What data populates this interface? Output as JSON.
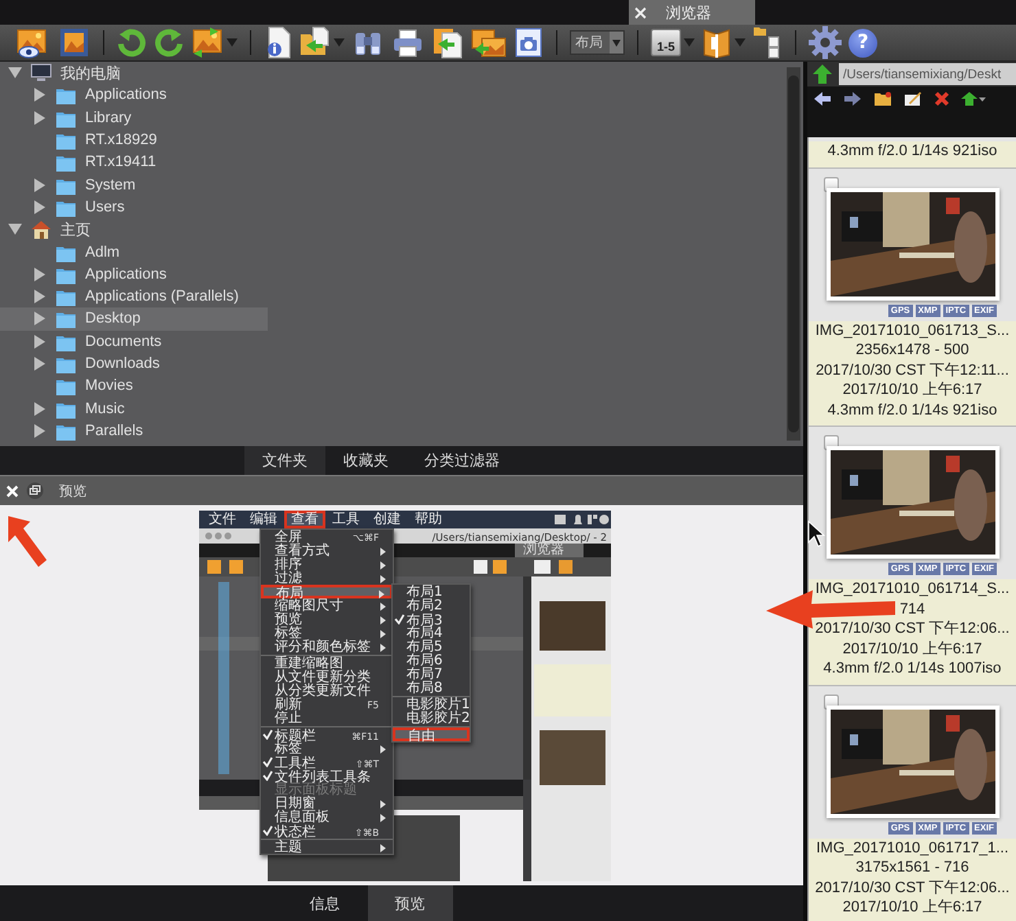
{
  "top_bar": {
    "tab": {
      "title": "浏览器"
    }
  },
  "toolbar": {
    "layout_dropdown": {
      "value": "布局"
    },
    "range_label": "1-5",
    "help_label": "?"
  },
  "folder_tree": {
    "items": [
      {
        "kind": "computer",
        "label": "我的电脑",
        "expandable": true,
        "expanded": true,
        "selected": false,
        "children": [
          {
            "kind": "folder",
            "label": "Applications",
            "expandable": true,
            "expanded": false,
            "selected": false
          },
          {
            "kind": "folder",
            "label": "Library",
            "expandable": true,
            "expanded": false,
            "selected": false
          },
          {
            "kind": "folder",
            "label": "RT.x18929",
            "expandable": false,
            "expanded": false,
            "selected": false
          },
          {
            "kind": "folder",
            "label": "RT.x19411",
            "expandable": false,
            "expanded": false,
            "selected": false
          },
          {
            "kind": "folder",
            "label": "System",
            "expandable": true,
            "expanded": false,
            "selected": false
          },
          {
            "kind": "folder",
            "label": "Users",
            "expandable": true,
            "expanded": false,
            "selected": false
          }
        ]
      },
      {
        "kind": "home",
        "label": "主页",
        "expandable": true,
        "expanded": true,
        "selected": false,
        "children": [
          {
            "kind": "folder",
            "label": "Adlm",
            "expandable": false,
            "expanded": false,
            "selected": false
          },
          {
            "kind": "folder",
            "label": "Applications",
            "expandable": true,
            "expanded": false,
            "selected": false
          },
          {
            "kind": "folder",
            "label": "Applications (Parallels)",
            "expandable": true,
            "expanded": false,
            "selected": false
          },
          {
            "kind": "folder",
            "label": "Desktop",
            "expandable": true,
            "expanded": false,
            "selected": true
          },
          {
            "kind": "folder",
            "label": "Documents",
            "expandable": true,
            "expanded": false,
            "selected": false
          },
          {
            "kind": "folder",
            "label": "Downloads",
            "expandable": true,
            "expanded": false,
            "selected": false
          },
          {
            "kind": "folder",
            "label": "Movies",
            "expandable": false,
            "expanded": false,
            "selected": false
          },
          {
            "kind": "folder",
            "label": "Music",
            "expandable": true,
            "expanded": false,
            "selected": false
          },
          {
            "kind": "folder",
            "label": "Parallels",
            "expandable": true,
            "expanded": false,
            "selected": false
          }
        ]
      }
    ]
  },
  "folder_tabs": [
    {
      "label": "文件夹",
      "selected": true
    },
    {
      "label": "收藏夹",
      "selected": false
    },
    {
      "label": "分类过滤器",
      "selected": false
    }
  ],
  "preview_panel": {
    "title": "预览",
    "image": {
      "menu_bar": [
        {
          "label": "文件",
          "marked": false
        },
        {
          "label": "编辑",
          "marked": false
        },
        {
          "label": "查看",
          "marked": true
        },
        {
          "label": "工具",
          "marked": false
        },
        {
          "label": "创建",
          "marked": false
        },
        {
          "label": "帮助",
          "marked": false
        }
      ],
      "window_path": "/Users/tiansemixiang/Desktop/ - 2",
      "window_tab": "浏览器",
      "menu": [
        {
          "kind": "item",
          "label": "全屏",
          "shortcut": "⌥⌘F",
          "checked": false,
          "has_submenu": false,
          "disabled": false,
          "marked": false
        },
        {
          "kind": "item",
          "label": "查看方式",
          "checked": false,
          "has_submenu": true,
          "disabled": false,
          "marked": false
        },
        {
          "kind": "item",
          "label": "排序",
          "checked": false,
          "has_submenu": true,
          "disabled": false,
          "marked": false
        },
        {
          "kind": "item",
          "label": "过滤",
          "checked": false,
          "has_submenu": true,
          "disabled": false,
          "marked": false
        },
        {
          "kind": "item",
          "label": "布局",
          "checked": false,
          "has_submenu": true,
          "disabled": false,
          "marked": true
        },
        {
          "kind": "item",
          "label": "缩略图尺寸",
          "checked": false,
          "has_submenu": true,
          "disabled": false,
          "marked": false
        },
        {
          "kind": "item",
          "label": "预览",
          "checked": false,
          "has_submenu": true,
          "disabled": false,
          "marked": false
        },
        {
          "kind": "item",
          "label": "标签",
          "checked": false,
          "has_submenu": true,
          "disabled": false,
          "marked": false
        },
        {
          "kind": "item",
          "label": "评分和颜色标签",
          "checked": false,
          "has_submenu": true,
          "disabled": false,
          "marked": false
        },
        {
          "kind": "separator"
        },
        {
          "kind": "item",
          "label": "重建缩略图",
          "checked": false,
          "has_submenu": false,
          "disabled": false,
          "marked": false
        },
        {
          "kind": "item",
          "label": "从文件更新分类",
          "checked": false,
          "has_submenu": false,
          "disabled": false,
          "marked": false
        },
        {
          "kind": "item",
          "label": "从分类更新文件",
          "checked": false,
          "has_submenu": false,
          "disabled": false,
          "marked": false
        },
        {
          "kind": "item",
          "label": "刷新",
          "shortcut": "F5",
          "checked": false,
          "has_submenu": false,
          "disabled": false,
          "marked": false
        },
        {
          "kind": "item",
          "label": "停止",
          "checked": false,
          "has_submenu": false,
          "disabled": false,
          "marked": false
        },
        {
          "kind": "separator"
        },
        {
          "kind": "item",
          "label": "标题栏",
          "shortcut": "⌘F11",
          "checked": true,
          "has_submenu": false,
          "disabled": false,
          "marked": false
        },
        {
          "kind": "item",
          "label": "标签",
          "checked": false,
          "has_submenu": true,
          "disabled": false,
          "marked": false
        },
        {
          "kind": "item",
          "label": "工具栏",
          "shortcut": "⇧⌘T",
          "checked": true,
          "has_submenu": false,
          "disabled": false,
          "marked": false
        },
        {
          "kind": "item",
          "label": "文件列表工具条",
          "checked": true,
          "has_submenu": false,
          "disabled": false,
          "marked": false
        },
        {
          "kind": "item",
          "label": "显示面板标题",
          "checked": false,
          "has_submenu": false,
          "disabled": true,
          "marked": false
        },
        {
          "kind": "item",
          "label": "日期窗",
          "checked": false,
          "has_submenu": true,
          "disabled": false,
          "marked": false
        },
        {
          "kind": "item",
          "label": "信息面板",
          "checked": false,
          "has_submenu": true,
          "disabled": false,
          "marked": false
        },
        {
          "kind": "item",
          "label": "状态栏",
          "shortcut": "⇧⌘B",
          "checked": true,
          "has_submenu": false,
          "disabled": false,
          "marked": false
        },
        {
          "kind": "separator"
        },
        {
          "kind": "item",
          "label": "主题",
          "checked": false,
          "has_submenu": true,
          "disabled": false,
          "marked": false
        }
      ],
      "submenu": [
        {
          "kind": "item",
          "label": "布局1",
          "checked": false,
          "marked": false
        },
        {
          "kind": "item",
          "label": "布局2",
          "checked": false,
          "marked": false
        },
        {
          "kind": "item",
          "label": "布局3",
          "checked": true,
          "marked": false
        },
        {
          "kind": "item",
          "label": "布局4",
          "checked": false,
          "marked": false
        },
        {
          "kind": "item",
          "label": "布局5",
          "checked": false,
          "marked": false
        },
        {
          "kind": "item",
          "label": "布局6",
          "checked": false,
          "marked": false
        },
        {
          "kind": "item",
          "label": "布局7",
          "checked": false,
          "marked": false
        },
        {
          "kind": "item",
          "label": "布局8",
          "checked": false,
          "marked": false
        },
        {
          "kind": "separator"
        },
        {
          "kind": "item",
          "label": "电影胶片1",
          "checked": false,
          "marked": false
        },
        {
          "kind": "item",
          "label": "电影胶片2",
          "checked": false,
          "marked": false
        },
        {
          "kind": "separator"
        },
        {
          "kind": "item",
          "label": "自由",
          "checked": false,
          "marked": true
        }
      ]
    }
  },
  "bottom_tabs": [
    {
      "label": "信息",
      "selected": false
    },
    {
      "label": "预览",
      "selected": true
    }
  ],
  "browser_panel": {
    "path": "/Users/tiansemixiang/Deskt",
    "thumbnails": [
      {
        "kind": "caption_only",
        "lines": [
          "4.3mm f/2.0 1/14s 921iso"
        ]
      },
      {
        "kind": "full",
        "checked": false,
        "tags": [
          "GPS",
          "XMP",
          "IPTC",
          "EXIF"
        ],
        "lines": [
          "IMG_20171010_061713_S...",
          "2356x1478 - 500",
          "2017/10/30 CST 下午12:11...",
          "2017/10/10 上午6:17",
          "4.3mm f/2.0 1/14s 921iso"
        ]
      },
      {
        "kind": "full",
        "checked": false,
        "tags": [
          "GPS",
          "XMP",
          "IPTC",
          "EXIF"
        ],
        "lines": [
          "IMG_20171010_061714_S...",
          "714",
          "2017/10/30 CST 下午12:06...",
          "2017/10/10 上午6:17",
          "4.3mm f/2.0 1/14s 1007iso"
        ]
      },
      {
        "kind": "full",
        "checked": false,
        "tags": [
          "GPS",
          "XMP",
          "IPTC",
          "EXIF"
        ],
        "lines": [
          "IMG_20171010_061717_1...",
          "3175x1561 - 716",
          "2017/10/30 CST 下午12:06...",
          "2017/10/10 上午6:17"
        ]
      }
    ]
  }
}
